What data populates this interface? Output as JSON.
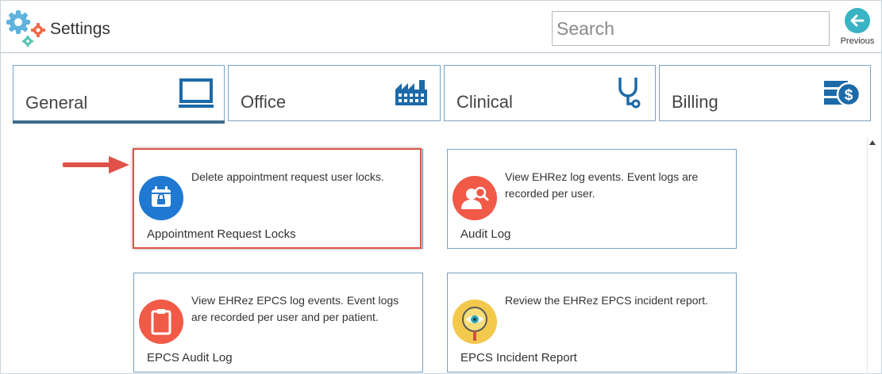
{
  "header": {
    "title": "Settings",
    "search_placeholder": "Search",
    "previous_label": "Previous"
  },
  "tabs": [
    {
      "label": "General",
      "icon": "monitor-icon",
      "active": true
    },
    {
      "label": "Office",
      "icon": "factory-icon",
      "active": false
    },
    {
      "label": "Clinical",
      "icon": "stethoscope-icon",
      "active": false
    },
    {
      "label": "Billing",
      "icon": "money-stack-icon",
      "active": false
    }
  ],
  "cards": [
    {
      "title": "Appointment Request Locks",
      "description": "Delete appointment request user locks.",
      "icon": "calendar-lock-icon",
      "icon_color": "#1f78d1",
      "highlighted": true
    },
    {
      "title": "Audit Log",
      "description": "View EHRez log events. Event logs are recorded per user.",
      "icon": "user-search-icon",
      "icon_color": "#f05a47"
    },
    {
      "title": "EPCS Audit Log",
      "description": "View EHRez EPCS log events. Event logs are recorded per user and per patient.",
      "icon": "clipboard-icon",
      "icon_color": "#f05a47"
    },
    {
      "title": "EPCS Incident Report",
      "description": "Review the EHRez EPCS incident report.",
      "icon": "magnifier-eye-icon",
      "icon_color": "#f2c94c"
    }
  ],
  "colors": {
    "accent": "#3d6a8c",
    "tab_border": "#7aa2c2",
    "highlight": "#e05247",
    "previous_button": "#3ab3c4"
  }
}
